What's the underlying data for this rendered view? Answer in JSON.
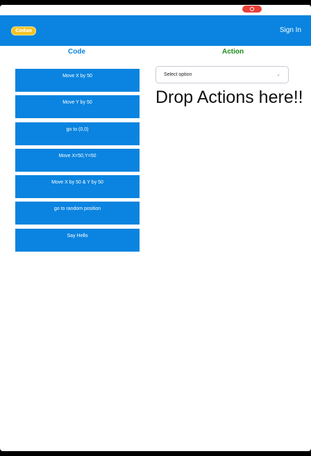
{
  "header": {
    "logo_text": "Coduo",
    "sign_in_label": "Sign In"
  },
  "columns": {
    "code_title": "Code",
    "action_title": "Action"
  },
  "code_blocks": [
    "Move X by 50",
    "Move Y by 50",
    "go to (0,0)",
    "Move X=50,Y=50",
    "Move X by 50 & Y by 50",
    "go to random position",
    "Say Hello"
  ],
  "action_select": {
    "value": "Select option",
    "caret": "⌄"
  },
  "drop_zone": {
    "text": "Drop Actions here!!"
  },
  "colors": {
    "brand_blue": "#0a84e0",
    "action_green": "#1a8a1a",
    "logo_yellow": "#f7c325",
    "record_red": "#e8403a"
  }
}
